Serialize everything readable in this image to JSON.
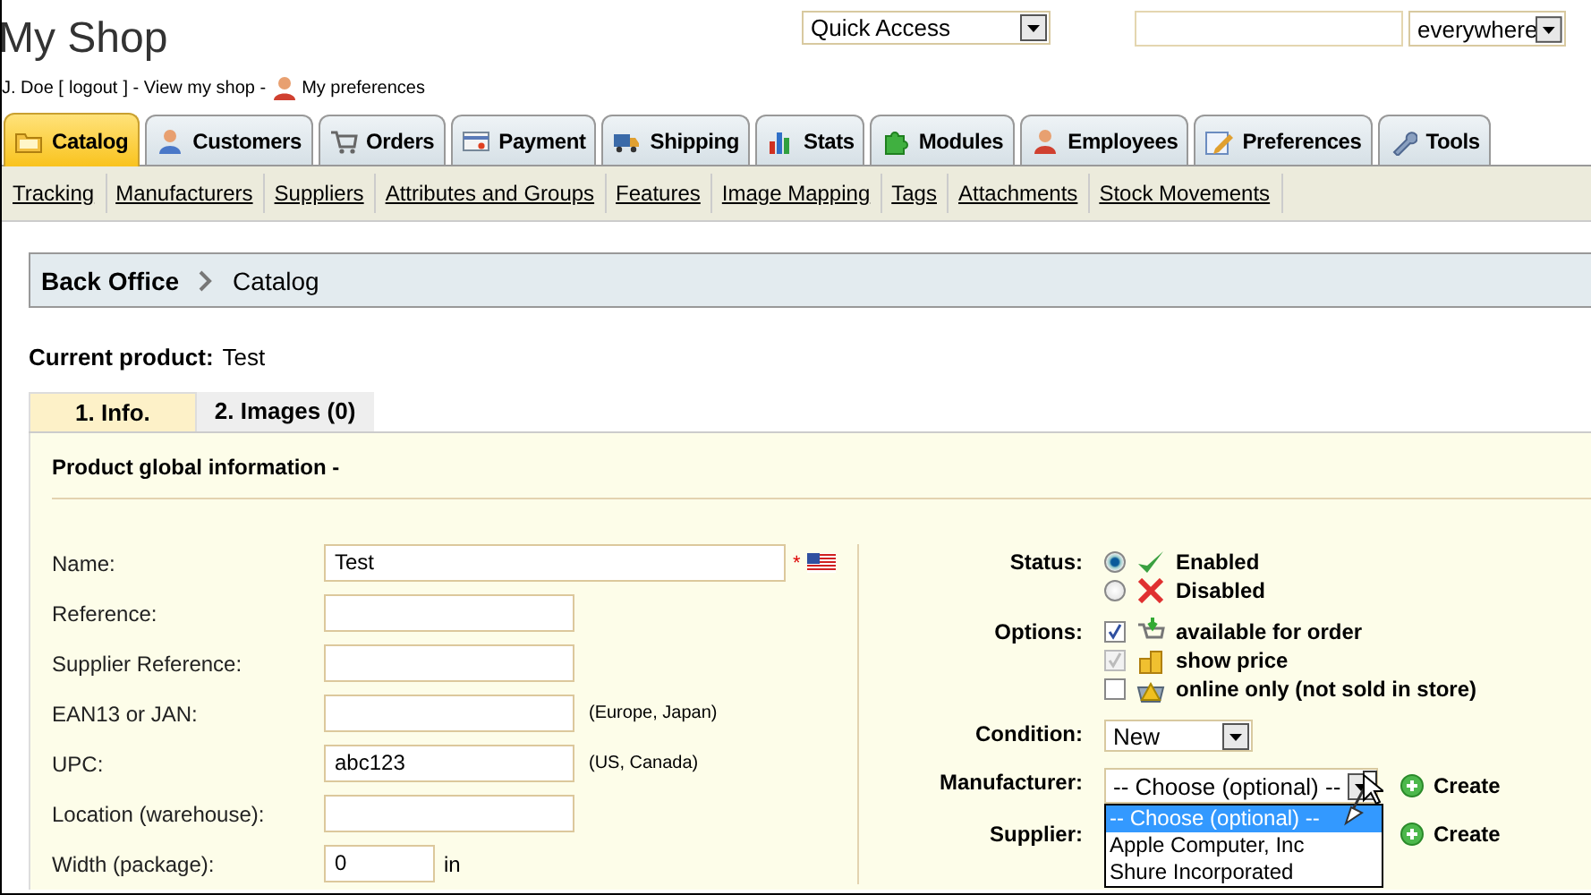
{
  "header": {
    "title": "My Shop",
    "quick_access": "Quick Access",
    "search_scope": "everywhere"
  },
  "user_bar": {
    "name": "J. Doe [",
    "logout": "logout",
    "middle": "] - View my shop -",
    "preferences": "My preferences"
  },
  "tabs": [
    {
      "label": "Catalog",
      "selected": true
    },
    {
      "label": "Customers",
      "selected": false
    },
    {
      "label": "Orders",
      "selected": false
    },
    {
      "label": "Payment",
      "selected": false
    },
    {
      "label": "Shipping",
      "selected": false
    },
    {
      "label": "Stats",
      "selected": false
    },
    {
      "label": "Modules",
      "selected": false
    },
    {
      "label": "Employees",
      "selected": false
    },
    {
      "label": "Preferences",
      "selected": false
    },
    {
      "label": "Tools",
      "selected": false
    }
  ],
  "subnav": [
    "Tracking",
    "Manufacturers",
    "Suppliers",
    "Attributes and Groups",
    "Features",
    "Image Mapping",
    "Tags",
    "Attachments",
    "Stock Movements"
  ],
  "breadcrumb": [
    "Back Office",
    "Catalog"
  ],
  "current_product": {
    "label": "Current product:",
    "value": "Test"
  },
  "product_tabs": [
    {
      "label": "1. Info.",
      "selected": true
    },
    {
      "label": "2. Images (0)",
      "selected": false
    }
  ],
  "section_title": "Product global information -",
  "fields": [
    {
      "label": "Name:",
      "value": "Test",
      "kind": "wide",
      "required_mark": "*"
    },
    {
      "label": "Reference:",
      "kind": "normal"
    },
    {
      "label": "Supplier Reference:",
      "kind": "normal"
    },
    {
      "label": "EAN13 or JAN:",
      "kind": "normal",
      "note": "(Europe, Japan)"
    },
    {
      "label": "UPC:",
      "value": "abc123",
      "kind": "normal",
      "note": "(US, Canada)"
    },
    {
      "label": "Location (warehouse):",
      "kind": "normal"
    },
    {
      "label": "Width (package):",
      "value": "0",
      "kind": "short",
      "unit": "in"
    }
  ],
  "status": {
    "label": "Status:",
    "options": [
      {
        "label": "Enabled",
        "selected": true
      },
      {
        "label": "Disabled",
        "selected": false
      }
    ]
  },
  "options": {
    "label": "Options:",
    "items": [
      {
        "label": "available for order",
        "checked": true,
        "disabled": false
      },
      {
        "label": "show price",
        "checked": true,
        "disabled": true
      },
      {
        "label": "online only (not sold in store)",
        "checked": false,
        "disabled": false
      }
    ]
  },
  "condition": {
    "label": "Condition:",
    "value": "New"
  },
  "manufacturer": {
    "label": "Manufacturer:",
    "value": "-- Choose (optional) --",
    "create": "Create",
    "dropdown": [
      {
        "label": "-- Choose (optional) --",
        "selected": true
      },
      {
        "label": "Apple Computer, Inc",
        "selected": false
      },
      {
        "label": "Shure Incorporated",
        "selected": false
      }
    ]
  },
  "supplier": {
    "label": "Supplier:",
    "create": "Create"
  }
}
